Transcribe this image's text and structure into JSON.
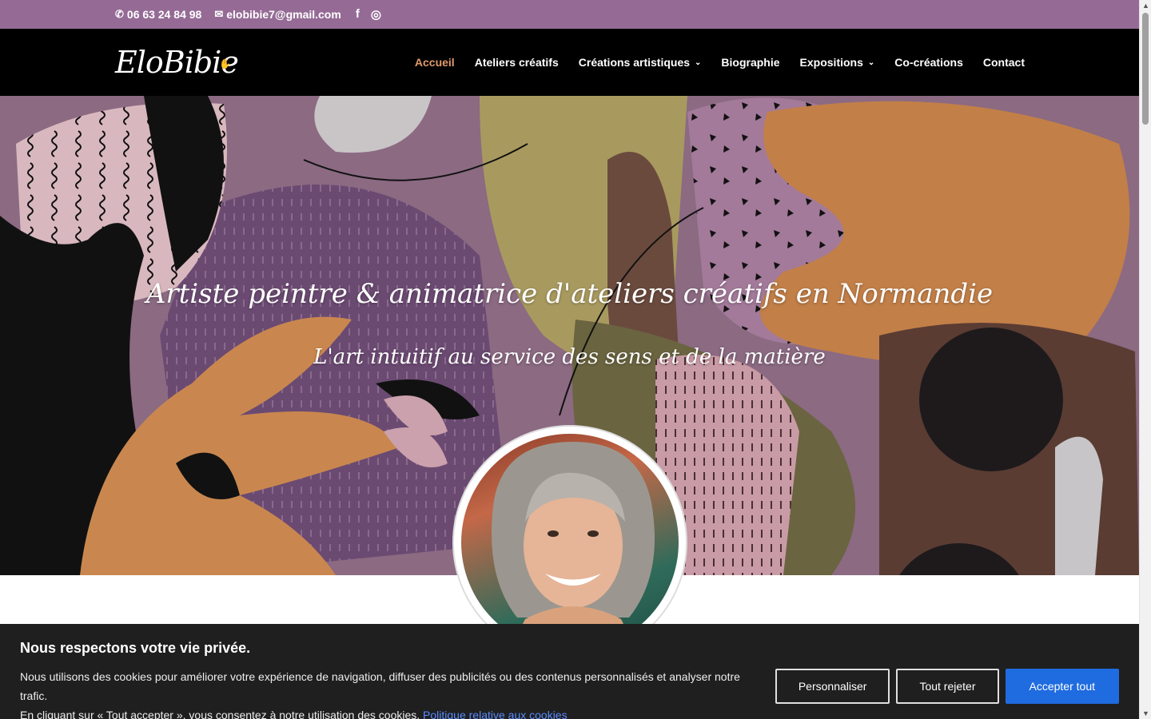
{
  "topbar": {
    "phone": "06 63 24 84 98",
    "email": "elobibie7@gmail.com",
    "icons": [
      "phone-icon",
      "envelope-icon",
      "facebook-icon",
      "instagram-icon"
    ]
  },
  "header": {
    "logo_text": "EloBibie",
    "nav": [
      {
        "label": "Accueil",
        "active": true
      },
      {
        "label": "Ateliers créatifs"
      },
      {
        "label": "Créations artistiques",
        "dropdown": true
      },
      {
        "label": "Biographie"
      },
      {
        "label": "Expositions",
        "dropdown": true
      },
      {
        "label": "Co-créations"
      },
      {
        "label": "Contact"
      }
    ]
  },
  "hero": {
    "title": "Artiste peintre & animatrice d'ateliers créatifs en Normandie",
    "subtitle": "L'art intuitif au service des sens et de la matière"
  },
  "cookie": {
    "title": "Nous respectons votre vie privée.",
    "line1": "Nous utilisons des cookies pour améliorer votre expérience de navigation, diffuser des publicités ou des contenus personnalisés et analyser notre trafic.",
    "line2": "En cliquant sur « Tout accepter », vous consentez à notre utilisation des cookies.",
    "policy_link": "Politique relative aux cookies",
    "btn_customize": "Personnaliser",
    "btn_reject": "Tout rejeter",
    "btn_accept": "Accepter tout"
  },
  "colors": {
    "topbar": "#956b96",
    "accent_nav": "#e09a6a",
    "accept_button": "#1f6be0"
  }
}
